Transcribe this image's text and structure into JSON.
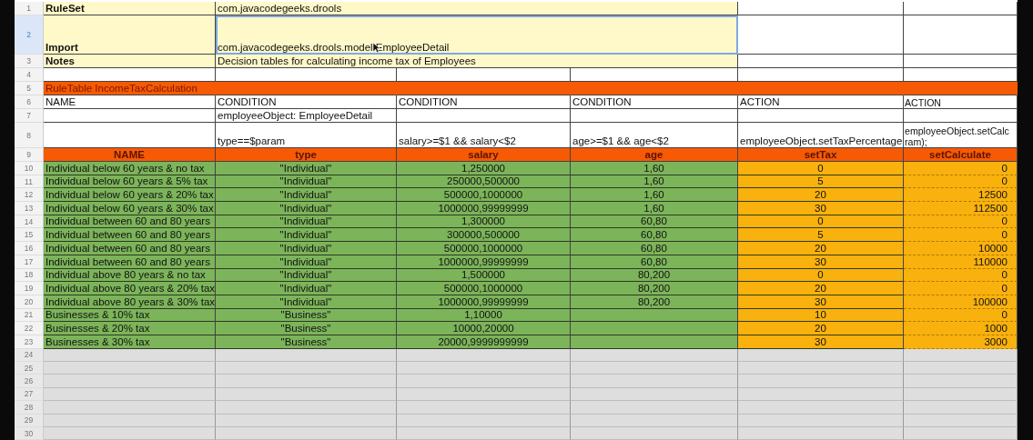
{
  "rows": [
    {
      "number": "1",
      "kind": "meta",
      "selected": false,
      "cells": [
        {
          "text": "RuleSet"
        },
        {
          "text": "com.javacodegeeks.drools"
        },
        null,
        null
      ]
    },
    {
      "number": "2",
      "kind": "meta",
      "selected": true,
      "cells": [
        {
          "text": "Import"
        },
        {
          "text": "com.javacodegeeks.drools.model.EmployeeDetail"
        },
        null,
        null
      ]
    },
    {
      "number": "3",
      "kind": "meta",
      "selected": false,
      "cells": [
        {
          "text": "Notes"
        },
        {
          "text": "Decision tables for calculating income tax of Employees"
        },
        null,
        null
      ]
    },
    {
      "number": "4",
      "kind": "blank",
      "selected": false,
      "cells": [
        null,
        null,
        null,
        null,
        null,
        null
      ]
    },
    {
      "number": "5",
      "kind": "title",
      "selected": false,
      "cells": [
        {
          "text": "RuleTable IncomeTaxCalculation"
        },
        null,
        null,
        null,
        null,
        null
      ]
    },
    {
      "number": "6",
      "kind": "plain",
      "selected": false,
      "cells": [
        {
          "text": "NAME"
        },
        {
          "text": "CONDITION"
        },
        {
          "text": "CONDITION"
        },
        {
          "text": "CONDITION"
        },
        {
          "text": "ACTION"
        },
        {
          "text": "ACTION"
        }
      ]
    },
    {
      "number": "7",
      "kind": "plain",
      "selected": false,
      "cells": [
        null,
        {
          "text": "employeeObject: EmployeeDetail"
        },
        null,
        null,
        null,
        null
      ]
    },
    {
      "number": "8",
      "kind": "plain",
      "selected": false,
      "cells": [
        null,
        {
          "text": "type==$param"
        },
        {
          "text": "salary>=$1 && salary<$2"
        },
        {
          "text": "age>=$1 && age<$2"
        },
        {
          "text": "employeeObject.setTaxPercentage"
        },
        {
          "text": "employeeObject.setCalc\nram);"
        }
      ]
    },
    {
      "number": "9",
      "kind": "header",
      "selected": false,
      "cells": [
        {
          "text": "NAME"
        },
        {
          "text": "type"
        },
        {
          "text": "salary"
        },
        {
          "text": "age"
        },
        {
          "text": "setTax"
        },
        {
          "text": "setCalculate"
        }
      ]
    },
    {
      "number": "10",
      "kind": "data",
      "selected": false,
      "cells": [
        {
          "text": "Individual below 60 years & no tax"
        },
        {
          "text": "\"Individual\""
        },
        {
          "text": "1,250000"
        },
        {
          "text": "1,60"
        },
        {
          "text": "0"
        },
        {
          "text": "0"
        }
      ]
    },
    {
      "number": "11",
      "kind": "data",
      "selected": false,
      "cells": [
        {
          "text": "Individual below 60 years & 5% tax"
        },
        {
          "text": "\"Individual\""
        },
        {
          "text": "250000,500000"
        },
        {
          "text": "1,60"
        },
        {
          "text": "5"
        },
        {
          "text": "0"
        }
      ]
    },
    {
      "number": "12",
      "kind": "data",
      "selected": false,
      "cells": [
        {
          "text": "Individual below 60 years & 20% tax"
        },
        {
          "text": "\"Individual\""
        },
        {
          "text": "500000,1000000"
        },
        {
          "text": "1,60"
        },
        {
          "text": "20"
        },
        {
          "text": "12500"
        }
      ]
    },
    {
      "number": "13",
      "kind": "data",
      "selected": false,
      "cells": [
        {
          "text": "Individual below 60 years & 30% tax"
        },
        {
          "text": "\"Individual\""
        },
        {
          "text": "1000000,99999999"
        },
        {
          "text": "1,60"
        },
        {
          "text": "30"
        },
        {
          "text": "112500"
        }
      ]
    },
    {
      "number": "14",
      "kind": "data",
      "selected": false,
      "cells": [
        {
          "text": "Individual between 60 and 80 years"
        },
        {
          "text": "\"Individual\""
        },
        {
          "text": "1,300000"
        },
        {
          "text": "60,80"
        },
        {
          "text": "0"
        },
        {
          "text": "0"
        }
      ]
    },
    {
      "number": "15",
      "kind": "data",
      "selected": false,
      "cells": [
        {
          "text": "Individual between 60 and 80 years"
        },
        {
          "text": "\"Individual\""
        },
        {
          "text": "300000,500000"
        },
        {
          "text": "60,80"
        },
        {
          "text": "5"
        },
        {
          "text": "0"
        }
      ]
    },
    {
      "number": "16",
      "kind": "data",
      "selected": false,
      "cells": [
        {
          "text": "Individual between 60 and 80 years"
        },
        {
          "text": "\"Individual\""
        },
        {
          "text": "500000,1000000"
        },
        {
          "text": "60,80"
        },
        {
          "text": "20"
        },
        {
          "text": "10000"
        }
      ]
    },
    {
      "number": "17",
      "kind": "data",
      "selected": false,
      "cells": [
        {
          "text": "Individual between 60 and 80 years"
        },
        {
          "text": "\"Individual\""
        },
        {
          "text": "1000000,99999999"
        },
        {
          "text": "60,80"
        },
        {
          "text": "30"
        },
        {
          "text": "110000"
        }
      ]
    },
    {
      "number": "18",
      "kind": "data",
      "selected": false,
      "cells": [
        {
          "text": "Individual above 80 years & no tax"
        },
        {
          "text": "\"Individual\""
        },
        {
          "text": "1,500000"
        },
        {
          "text": "80,200"
        },
        {
          "text": "0"
        },
        {
          "text": "0"
        }
      ]
    },
    {
      "number": "19",
      "kind": "data",
      "selected": false,
      "cells": [
        {
          "text": "Individual above 80 years & 20% tax"
        },
        {
          "text": "\"Individual\""
        },
        {
          "text": "500000,1000000"
        },
        {
          "text": "80,200"
        },
        {
          "text": "20"
        },
        {
          "text": "0"
        }
      ]
    },
    {
      "number": "20",
      "kind": "data",
      "selected": false,
      "cells": [
        {
          "text": "Individual above 80 years & 30% tax"
        },
        {
          "text": "\"Individual\""
        },
        {
          "text": "1000000,99999999"
        },
        {
          "text": "80,200"
        },
        {
          "text": "30"
        },
        {
          "text": "100000"
        }
      ]
    },
    {
      "number": "21",
      "kind": "data",
      "selected": false,
      "cells": [
        {
          "text": "Businesses & 10% tax"
        },
        {
          "text": "\"Business\""
        },
        {
          "text": "1,10000"
        },
        null,
        {
          "text": "10"
        },
        {
          "text": "0"
        }
      ]
    },
    {
      "number": "22",
      "kind": "data",
      "selected": false,
      "cells": [
        {
          "text": "Businesses & 20% tax"
        },
        {
          "text": "\"Business\""
        },
        {
          "text": "10000,20000"
        },
        null,
        {
          "text": "20"
        },
        {
          "text": "1000"
        }
      ]
    },
    {
      "number": "23",
      "kind": "data",
      "selected": false,
      "cells": [
        {
          "text": "Businesses & 30% tax"
        },
        {
          "text": "\"Business\""
        },
        {
          "text": "20000,9999999999"
        },
        null,
        {
          "text": "30"
        },
        {
          "text": "3000"
        }
      ]
    },
    {
      "number": "24",
      "kind": "empty",
      "selected": false,
      "cells": [
        null,
        null,
        null,
        null,
        null,
        null
      ]
    },
    {
      "number": "25",
      "kind": "empty",
      "selected": false,
      "cells": [
        null,
        null,
        null,
        null,
        null,
        null
      ]
    },
    {
      "number": "26",
      "kind": "empty",
      "selected": false,
      "cells": [
        null,
        null,
        null,
        null,
        null,
        null
      ]
    },
    {
      "number": "27",
      "kind": "empty",
      "selected": false,
      "cells": [
        null,
        null,
        null,
        null,
        null,
        null
      ]
    },
    {
      "number": "28",
      "kind": "empty",
      "selected": false,
      "cells": [
        null,
        null,
        null,
        null,
        null,
        null
      ]
    },
    {
      "number": "29",
      "kind": "empty",
      "selected": false,
      "cells": [
        null,
        null,
        null,
        null,
        null,
        null
      ]
    },
    {
      "number": "30",
      "kind": "empty",
      "selected": false,
      "cells": [
        null,
        null,
        null,
        null,
        null,
        null
      ]
    }
  ]
}
